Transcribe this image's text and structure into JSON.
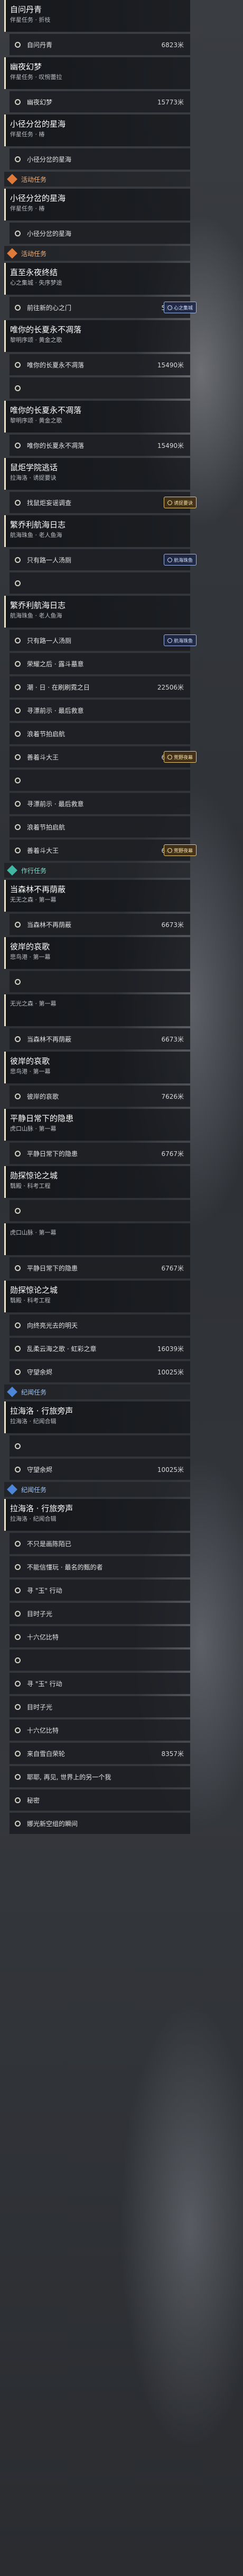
{
  "colors": {
    "event": "#e07a3a",
    "follow": "#3fb7a4",
    "voyage": "#4d86d6",
    "quest_bar": "#e9e3cf"
  },
  "icons": {
    "step": "circle-outline-icon",
    "category": "diamond-icon"
  },
  "items": [
    {
      "kind": "quest",
      "title": "自问丹青",
      "sub": "伴星任务 · 折枝"
    },
    {
      "kind": "step",
      "text": "自问丹青",
      "dist": "6823米"
    },
    {
      "kind": "quest",
      "title": "幽夜幻梦",
      "sub": "伴星任务 · 叹惋蕾拉"
    },
    {
      "kind": "step",
      "text": "幽夜幻梦",
      "dist": "15773米"
    },
    {
      "kind": "quest",
      "title": "小径分岔的星海",
      "sub": "伴星任务 · 椿"
    },
    {
      "kind": "step",
      "text": "小径分岔的星海",
      "dist": ""
    },
    {
      "kind": "cat",
      "type": "event",
      "title": "活动任务"
    },
    {
      "kind": "quest",
      "title": "小径分岔的星海",
      "sub": "伴星任务 · 椿"
    },
    {
      "kind": "step",
      "text": "小径分岔的星海",
      "dist": ""
    },
    {
      "kind": "cat",
      "type": "event",
      "title": "活动任务"
    },
    {
      "kind": "quest",
      "title": "直至永夜终结",
      "sub": "心之集城 · 失序梦途"
    },
    {
      "kind": "step",
      "text": "前往新的心之门",
      "dist": "5064米",
      "badge": "心之集城"
    },
    {
      "kind": "quest",
      "title": "唯你的长夏永不凋落",
      "sub": "黎明序颂 · 黄金之歌"
    },
    {
      "kind": "step",
      "text": "唯你的长夏永不凋落",
      "dist": "15490米"
    },
    {
      "kind": "step",
      "text": "",
      "dist": ""
    },
    {
      "kind": "quest",
      "title": "唯你的长夏永不凋落",
      "sub": "黎明序颂 · 黄金之歌"
    },
    {
      "kind": "step",
      "text": "唯你的长夏永不凋落",
      "dist": "15490米"
    },
    {
      "kind": "quest",
      "title": "鼠炬学院逃话",
      "sub": "拉海洛 · 诱捉要诀"
    },
    {
      "kind": "step",
      "text": "找鼠炬妄谣调查",
      "dist": "",
      "badge": "诱捉要诀",
      "badge_gold": true
    },
    {
      "kind": "quest",
      "title": "繁乔利航海日志",
      "sub": "航海珠鱼 · 老人鱼海"
    },
    {
      "kind": "step",
      "text": "只有路一人汤厕",
      "dist": "",
      "badge": "航海珠鱼"
    },
    {
      "kind": "step",
      "text": "",
      "dist": ""
    },
    {
      "kind": "quest",
      "title": "繁乔利航海日志",
      "sub": "航海珠鱼 · 老人鱼海"
    },
    {
      "kind": "step",
      "text": "只有路一人汤厕",
      "dist": "",
      "badge": "航海珠鱼"
    },
    {
      "kind": "step",
      "text": "荣耀之后 · 露斗墓意",
      "dist": ""
    },
    {
      "kind": "step",
      "text": "潮 · 日 · 在刷刷霓之日",
      "dist": "22506米"
    },
    {
      "kind": "step",
      "text": "寻漂前示 · 最后救意",
      "dist": ""
    },
    {
      "kind": "step",
      "text": "浪着节拍启航",
      "dist": ""
    },
    {
      "kind": "step",
      "text": "善着斗大王",
      "dist": "6419米",
      "badge": "荒野夜幕",
      "badge_gold": true
    },
    {
      "kind": "step",
      "text": "",
      "dist": ""
    },
    {
      "kind": "step",
      "text": "寻漂前示 · 最后救意",
      "dist": ""
    },
    {
      "kind": "step",
      "text": "浪着节拍启航",
      "dist": ""
    },
    {
      "kind": "step",
      "text": "善着斗大王",
      "dist": "6419米",
      "badge": "荒野夜幕",
      "badge_gold": true
    },
    {
      "kind": "cat",
      "type": "follow",
      "title": "作行任务"
    },
    {
      "kind": "quest",
      "title": "当森林不再荫蔽",
      "sub": "无无之森 · 第一幕"
    },
    {
      "kind": "step",
      "text": "当森林不再荫蔽",
      "dist": "6673米"
    },
    {
      "kind": "quest",
      "title": "彼岸的哀歌",
      "sub": "悲鸟港 · 第一幕"
    },
    {
      "kind": "step",
      "text": "",
      "dist": ""
    },
    {
      "kind": "quest",
      "title": "",
      "sub": "无光之森 · 第一幕"
    },
    {
      "kind": "step",
      "text": "当森林不再荫蔽",
      "dist": "6673米"
    },
    {
      "kind": "quest",
      "title": "彼岸的哀歌",
      "sub": "悲鸟港 · 第一幕"
    },
    {
      "kind": "step",
      "text": "彼岸的哀歌",
      "dist": "7626米"
    },
    {
      "kind": "quest",
      "title": "平静日常下的隐患",
      "sub": "虎口山脉 · 第一幕"
    },
    {
      "kind": "step",
      "text": "平静日常下的隐患",
      "dist": "6767米"
    },
    {
      "kind": "quest",
      "title": "勋探惊论之城",
      "sub": "翳殿 · 科考工程"
    },
    {
      "kind": "step",
      "text": "",
      "dist": ""
    },
    {
      "kind": "quest",
      "title": "",
      "sub": "虎口山脉 · 第一幕"
    },
    {
      "kind": "step",
      "text": "平静日常下的隐患",
      "dist": "6767米"
    },
    {
      "kind": "quest",
      "title": "勋探惊论之城",
      "sub": "翳殿 · 科考工程"
    },
    {
      "kind": "step",
      "text": "向终亮光去的明天",
      "dist": ""
    },
    {
      "kind": "step",
      "text": "乱柔云海之歌 · 虹彩之章",
      "dist": "16039米"
    },
    {
      "kind": "step",
      "text": "守望余烬",
      "dist": "10025米"
    },
    {
      "kind": "cat",
      "type": "voyage",
      "title": "纪闻任务"
    },
    {
      "kind": "quest",
      "title": "拉海洛 · 行旅旁声",
      "sub": "拉海洛 · 纪闻合辑"
    },
    {
      "kind": "step",
      "text": "",
      "dist": ""
    },
    {
      "kind": "step",
      "text": "守望余烬",
      "dist": "10025米"
    },
    {
      "kind": "cat",
      "type": "voyage",
      "title": "纪闻任务"
    },
    {
      "kind": "quest",
      "title": "拉海洛 · 行旅旁声",
      "sub": "拉海洛 · 纪闻合辑"
    },
    {
      "kind": "step",
      "text": "不只是画陈陌已",
      "dist": ""
    },
    {
      "kind": "step",
      "text": "不能信懂玩 · 最名的甄的者",
      "dist": ""
    },
    {
      "kind": "step",
      "text": "寻 \"玉\" 行动",
      "dist": ""
    },
    {
      "kind": "step",
      "text": "目时子光",
      "dist": ""
    },
    {
      "kind": "step",
      "text": "十六亿比特",
      "dist": ""
    },
    {
      "kind": "step",
      "text": "",
      "dist": ""
    },
    {
      "kind": "step",
      "text": "寻 \"玉\" 行动",
      "dist": ""
    },
    {
      "kind": "step",
      "text": "目时子光",
      "dist": ""
    },
    {
      "kind": "step",
      "text": "十六亿比特",
      "dist": ""
    },
    {
      "kind": "step",
      "text": "来自雪白荣轮",
      "dist": "8357米"
    },
    {
      "kind": "step",
      "text": "耶耶, 再见, 世界上的另一个我",
      "dist": ""
    },
    {
      "kind": "step",
      "text": "秘密",
      "dist": ""
    },
    {
      "kind": "step",
      "text": "娜光新空组的瞬间",
      "dist": ""
    }
  ]
}
